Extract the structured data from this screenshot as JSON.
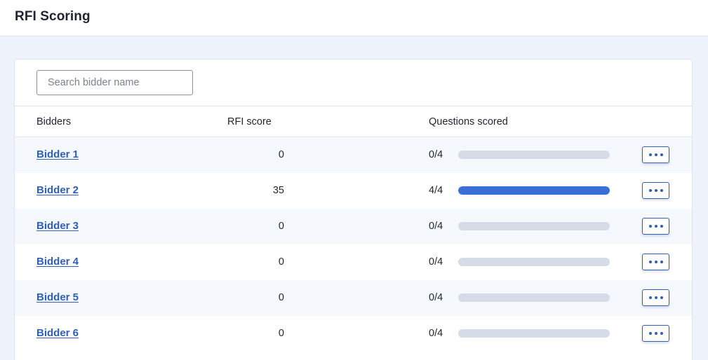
{
  "header": {
    "title": "RFI Scoring"
  },
  "search": {
    "placeholder": "Search bidder name",
    "value": ""
  },
  "table": {
    "columns": {
      "bidders": "Bidders",
      "rfi_score": "RFI score",
      "questions_scored": "Questions scored"
    },
    "rows": [
      {
        "bidder": "Bidder 1",
        "score": "0",
        "scored": "0/4",
        "progress": 0
      },
      {
        "bidder": "Bidder 2",
        "score": "35",
        "scored": "4/4",
        "progress": 1
      },
      {
        "bidder": "Bidder 3",
        "score": "0",
        "scored": "0/4",
        "progress": 0
      },
      {
        "bidder": "Bidder 4",
        "score": "0",
        "scored": "0/4",
        "progress": 0
      },
      {
        "bidder": "Bidder 5",
        "score": "0",
        "scored": "0/4",
        "progress": 0
      },
      {
        "bidder": "Bidder 6",
        "score": "0",
        "scored": "0/4",
        "progress": 0
      }
    ],
    "row_action_icon": "more-horizontal-icon"
  },
  "colors": {
    "accent": "#2f5fb7",
    "progress_fill": "#3a6fd8",
    "progress_track": "#d5dce8",
    "page_background": "#eef3fb"
  }
}
